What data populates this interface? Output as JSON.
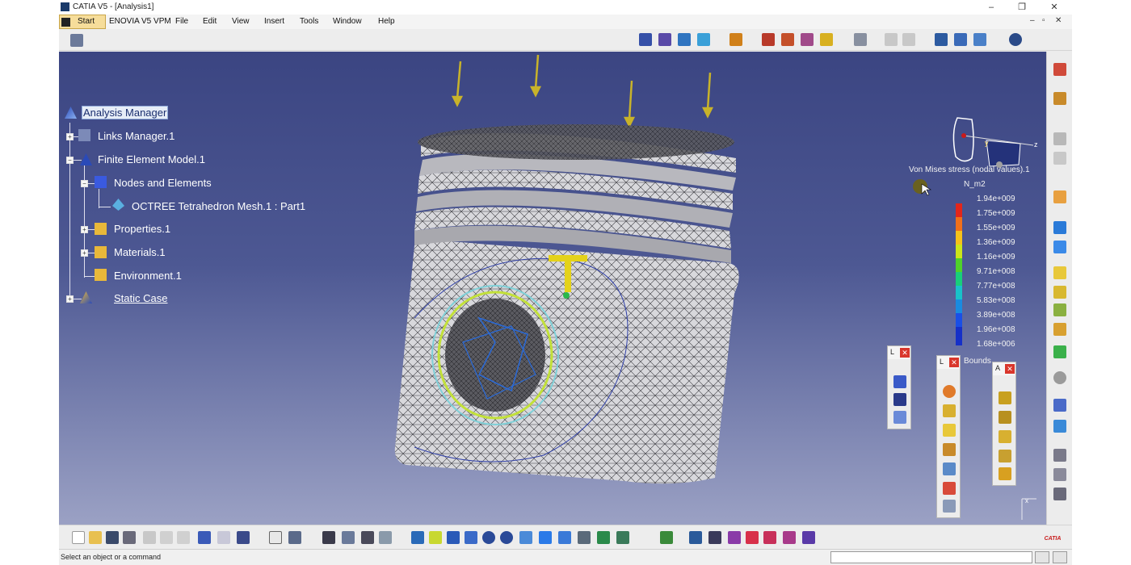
{
  "window": {
    "title": "CATIA V5 - [Analysis1]",
    "controls": {
      "minimize": "–",
      "restore": "❐",
      "close": "✕"
    },
    "mdi_controls": [
      "–",
      "▫",
      "✕"
    ]
  },
  "menu": {
    "items": [
      "Start",
      "ENOVIA V5 VPM",
      "File",
      "Edit",
      "View",
      "Insert",
      "Tools",
      "Window",
      "Help"
    ]
  },
  "tree": {
    "nodes": [
      {
        "label": "Analysis Manager",
        "icon": "analysis-manager-icon",
        "selected": true
      },
      {
        "label": "Links Manager.1",
        "icon": "links-manager-icon"
      },
      {
        "label": "Finite Element Model.1",
        "icon": "fem-icon"
      },
      {
        "label": "Nodes and Elements",
        "icon": "nodes-elements-icon"
      },
      {
        "label": "OCTREE Tetrahedron Mesh.1 : Part1",
        "icon": "mesh-icon"
      },
      {
        "label": "Properties.1",
        "icon": "folder-icon"
      },
      {
        "label": "Materials.1",
        "icon": "folder-icon"
      },
      {
        "label": "Environment.1",
        "icon": "folder-icon"
      },
      {
        "label": "Static Case",
        "icon": "static-case-icon"
      }
    ]
  },
  "legend": {
    "title": "Von Mises stress (nodal values).1",
    "unit": "N_m2",
    "values": [
      "1.94e+009",
      "1.75e+009",
      "1.55e+009",
      "1.36e+009",
      "1.16e+009",
      "9.71e+008",
      "7.77e+008",
      "5.83e+008",
      "3.89e+008",
      "1.96e+008",
      "1.68e+006"
    ],
    "footer": "Bounds",
    "colors": [
      "#e3261b",
      "#f0701a",
      "#f6c21a",
      "#cbe61a",
      "#4fd22a",
      "#18cf7a",
      "#19c2c9",
      "#1a8be0",
      "#1a4fe6",
      "#1630c8"
    ]
  },
  "mini_toolbars": [
    {
      "label": "L"
    },
    {
      "label": "L"
    },
    {
      "label": "A"
    }
  ],
  "status": {
    "prompt": "Select an object or a command"
  },
  "compass": {
    "x_label": "x",
    "y_label": "y",
    "z_label": "z"
  },
  "brand": "CATIA",
  "accent": "#3b4582"
}
